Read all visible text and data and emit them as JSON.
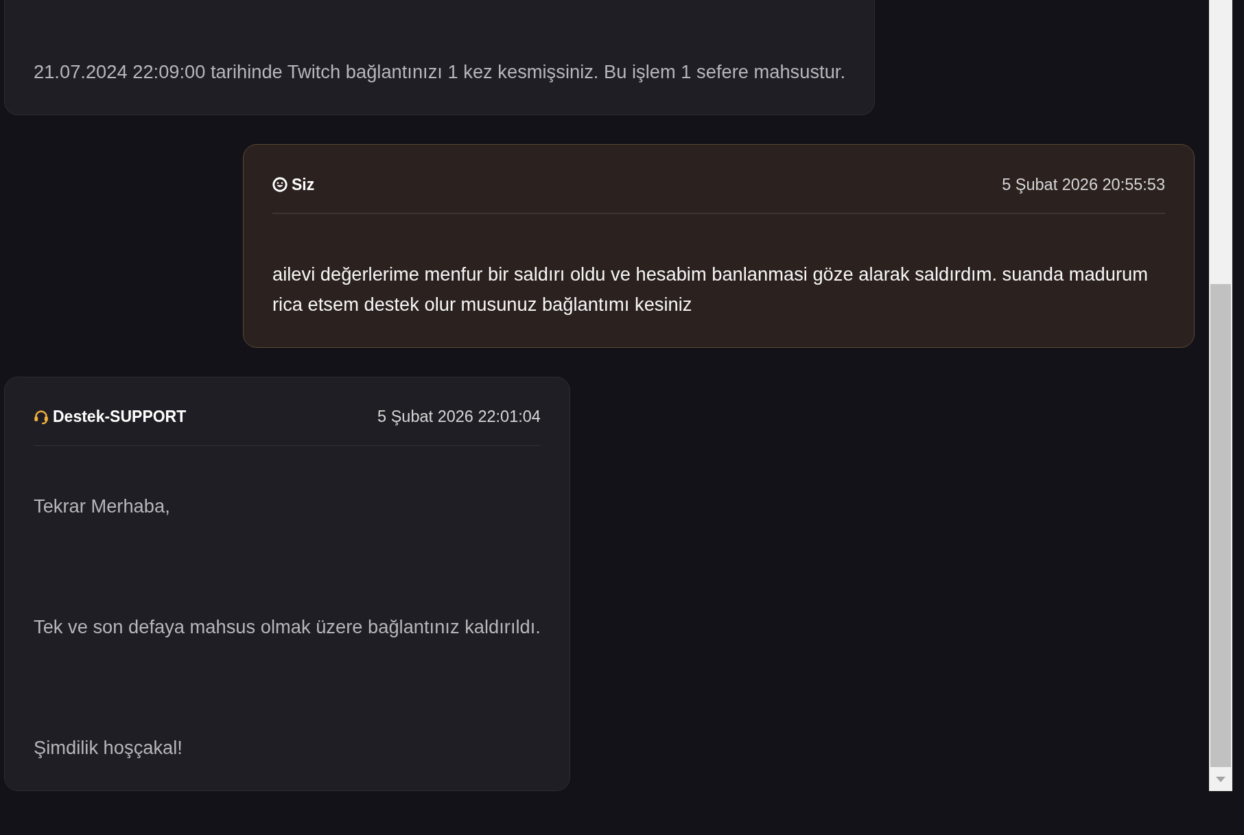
{
  "conversation": {
    "messages": [
      {
        "kind": "support",
        "paragraphs": [
          "21.07.2024 22:09:00 tarihinde Twitch bağlantınızı 1 kez kesmişsiniz. Bu işlem 1 sefere mahsustur."
        ]
      },
      {
        "kind": "user",
        "author": "Siz",
        "time": "5 Şubat 2026 20:55:53",
        "paragraphs": [
          "ailevi değerlerime menfur bir saldırı oldu ve hesabim banlanmasi göze alarak saldırdım. suanda madurum rica etsem destek olur musunuz bağlantımı kesiniz"
        ]
      },
      {
        "kind": "support",
        "author": "Destek-SUPPORT",
        "time": "5 Şubat 2026 22:01:04",
        "paragraphs": [
          "Tekrar Merhaba,",
          "Tek ve son defaya mahsus olmak üzere bağlantınız kaldırıldı.",
          "Şimdilik hoşçakal!"
        ]
      }
    ]
  }
}
